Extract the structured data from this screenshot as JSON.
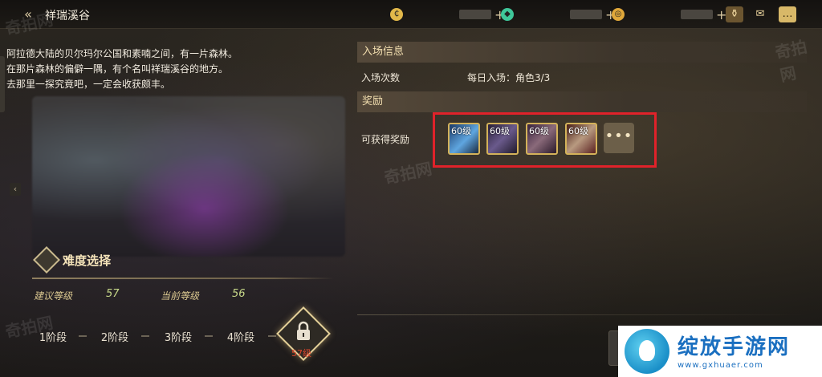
{
  "header": {
    "back_icon": "double-chevron-left-icon",
    "title": "祥瑞溪谷",
    "currencies": [
      {
        "icon": "gold-coin-icon",
        "symbol": "₵",
        "color": "#e2b84a"
      },
      {
        "icon": "crystal-icon",
        "symbol": "◆",
        "color": "#3fc79a"
      },
      {
        "icon": "medal-coin-icon",
        "symbol": "◎",
        "color": "#e0a83a"
      }
    ],
    "plus": "+",
    "icons": [
      "treasure-pot-icon",
      "mail-icon",
      "chat-icon"
    ]
  },
  "description": [
    "阿拉德大陆的贝尔玛尔公国和素喃之间，有一片森林。",
    "在那片森林的偏僻一隅，有个名叫祥瑞溪谷的地方。",
    "去那里一探究竟吧，一定会收获颇丰。"
  ],
  "difficulty": {
    "title": "难度选择",
    "recommended_label": "建议等级",
    "recommended_value": "57",
    "current_label": "当前等级",
    "current_value": "56",
    "stages": [
      "1阶段",
      "2阶段",
      "3阶段",
      "4阶段"
    ],
    "locked_level": "57级"
  },
  "entry": {
    "section_title": "入场信息",
    "count_label": "入场次数",
    "count_value": "每日入场：角色3/3"
  },
  "rewards": {
    "section_title": "奖励",
    "label": "可获得奖励",
    "items": [
      {
        "level": "60级",
        "icon": "blue-blade-icon",
        "color": "#3a6aa8"
      },
      {
        "level": "60级",
        "icon": "purple-sword-icon",
        "color": "#4a3a66"
      },
      {
        "level": "60级",
        "icon": "purple-gauntlet-icon",
        "color": "#5a4068"
      },
      {
        "level": "60级",
        "icon": "red-bow-icon",
        "color": "#6a2a24"
      }
    ],
    "more": "•••"
  },
  "watermark": "奇拍网",
  "site_logo": {
    "text": "绽放手游网",
    "url": "www.gxhuaer.com"
  }
}
